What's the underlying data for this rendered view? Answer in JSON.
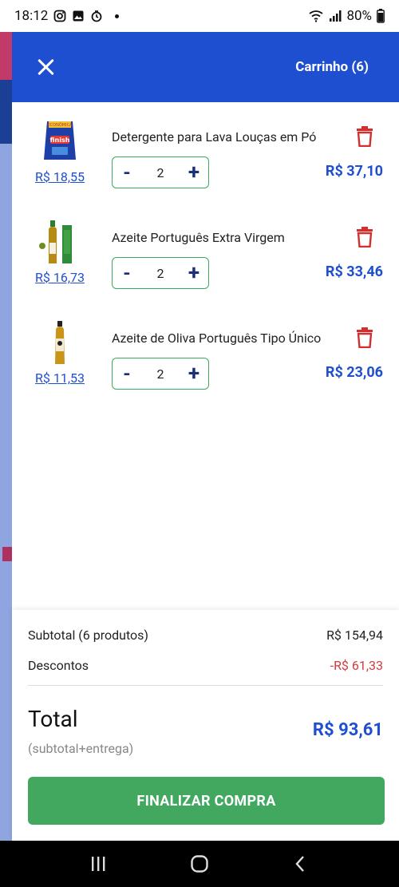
{
  "status_bar": {
    "time": "18:12",
    "battery": "80%"
  },
  "header": {
    "title": "Carrinho (6)"
  },
  "items": [
    {
      "name": "Detergente para Lava Louças em Pó",
      "unit_price": "R$ 18,55",
      "quantity": "2",
      "total": "R$ 37,10",
      "thumb_icon": "detergent-package-icon"
    },
    {
      "name": "Azeite Português Extra Virgem",
      "unit_price": "R$ 16,73",
      "quantity": "2",
      "total": "R$ 33,46",
      "thumb_icon": "olive-oil-bottle-icon"
    },
    {
      "name": "Azeite de Oliva Português Tipo Único",
      "unit_price": "R$ 11,53",
      "quantity": "2",
      "total": "R$ 23,06",
      "thumb_icon": "olive-oil-bottle-icon"
    }
  ],
  "stepper": {
    "minus": "-",
    "plus": "+"
  },
  "summary": {
    "subtotal_label": "Subtotal (6 produtos)",
    "subtotal_value": "R$ 154,94",
    "discount_label": "Descontos",
    "discount_value": "-R$ 61,33",
    "total_label": "Total",
    "total_sub": "(subtotal+entrega)",
    "total_value": "R$ 93,61",
    "checkout_label": "FINALIZAR COMPRA"
  },
  "colors": {
    "brand_blue": "#1f4fd1",
    "checkout_green": "#42a85f",
    "discount_red": "#d23b3b",
    "trash_red": "#d32f2f"
  }
}
